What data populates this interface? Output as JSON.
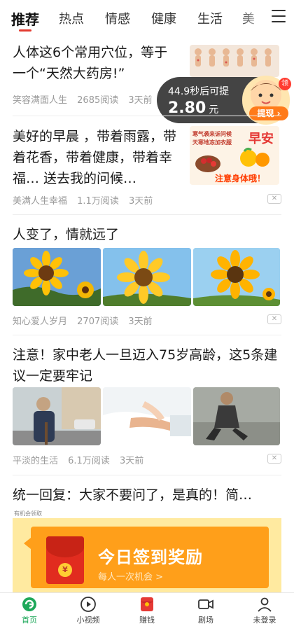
{
  "tabs": [
    {
      "label": "推荐",
      "active": true
    },
    {
      "label": "热点"
    },
    {
      "label": "情感"
    },
    {
      "label": "健康"
    },
    {
      "label": "生活"
    },
    {
      "label": "美"
    }
  ],
  "articles": [
    {
      "title": "人体这6个常用穴位，等于一个“天然大药房!”",
      "author": "笑容满面人生",
      "reads": "2685阅读",
      "time": "3天前"
    },
    {
      "title": "美好的早晨 ，带着雨露，带着花香，带着健康，带着幸福… 送去我的问候…",
      "author": "美满人生幸福",
      "reads": "1.1万阅读",
      "time": "3天前",
      "thumb_text": {
        "line1": "寒气袭来诉问候",
        "line2": "天寒地冻加衣服",
        "big": "早安",
        "bottom": "注意身体哦！"
      }
    },
    {
      "title": "人变了，情就远了",
      "author": "知心爱人岁月",
      "reads": "2707阅读",
      "time": "3天前"
    },
    {
      "title": "注意！家中老人一旦迈入75岁高龄，这5条建议一定要牢记",
      "author": "平淡的生活",
      "reads": "6.1万阅读",
      "time": "3天前"
    },
    {
      "title": "统一回复：大家不要问了，是真的！简…"
    }
  ],
  "reward": {
    "timer": "44.9秒后可提",
    "amount": "2.80",
    "unit": "元",
    "withdraw": "提现 ›",
    "badge": "领"
  },
  "ad": {
    "label": "有机会领取",
    "title": "今日签到奖励",
    "subtitle": "每人一次机会 >",
    "coin": "¥"
  },
  "close_label": "✕",
  "bottom_nav": [
    {
      "label": "首页",
      "active": true,
      "icon": "home-icon"
    },
    {
      "label": "小视频",
      "icon": "play-icon"
    },
    {
      "label": "赚钱",
      "icon": "red-envelope-icon"
    },
    {
      "label": "剧场",
      "icon": "video-camera-icon"
    },
    {
      "label": "未登录",
      "icon": "user-icon"
    }
  ],
  "colors": {
    "accent": "#e33a2f",
    "nav_active": "#1ea85a",
    "ad_orange": "#ff9f1a"
  }
}
